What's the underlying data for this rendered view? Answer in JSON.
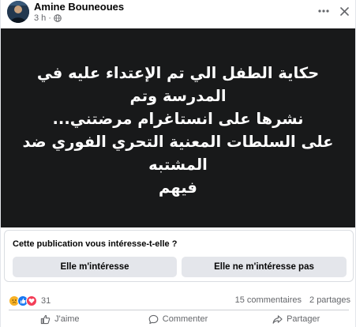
{
  "post": {
    "author": "Amine Bouneoues",
    "time": "3 h",
    "separator": "·",
    "text_lines": [
      "حكاية الطفل الي تم الإعتداء عليه في المدرسة وتم",
      "نشرها على انستاغرام مرضتني...",
      "على السلطات المعنية التحري الفوري ضد المشتبه",
      "فيهم"
    ],
    "background": "#18191a"
  },
  "icons": {
    "more": "more-options-icon",
    "close": "close-icon",
    "audience": "globe-icon"
  },
  "survey": {
    "question": "Cette publication vous intéresse-t-elle ?",
    "yes_label": "Elle m'intéresse",
    "no_label": "Elle ne m'intéresse pas"
  },
  "stats": {
    "reaction_count": "31",
    "comments": "15 commentaires",
    "shares": "2 partages"
  },
  "actions": {
    "like": "J'aime",
    "comment": "Commenter",
    "share": "Partager"
  },
  "colors": {
    "accent": "#1877f2",
    "secondary_text": "#65676b",
    "button_bg": "#e4e6eb"
  }
}
